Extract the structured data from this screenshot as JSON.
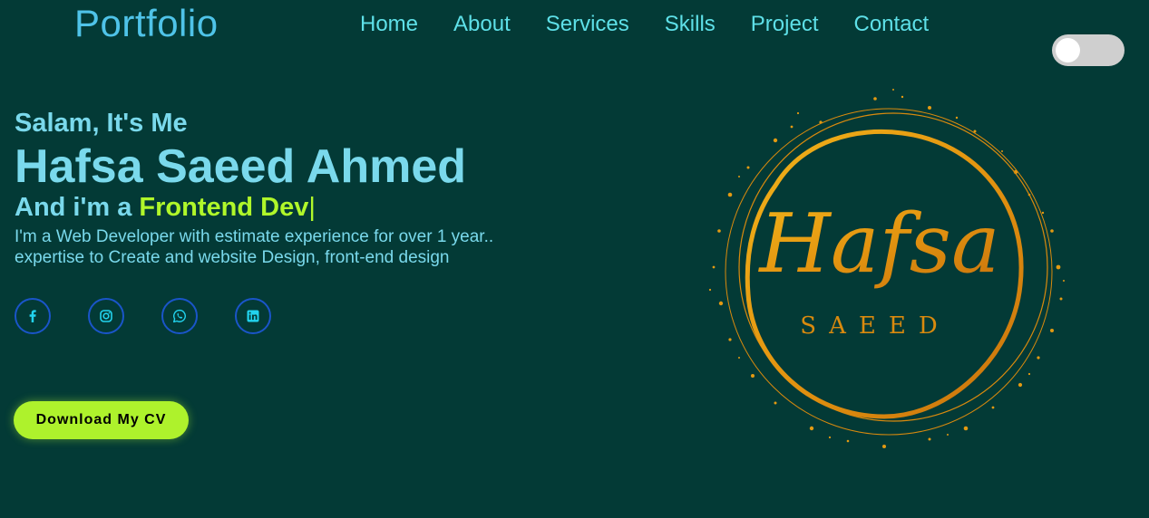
{
  "header": {
    "logo": "Portfolio",
    "nav": [
      "Home",
      "About",
      "Services",
      "Skills",
      "Project",
      "Contact"
    ]
  },
  "hero": {
    "greeting": "Salam, It's Me",
    "name": "Hafsa Saeed Ahmed",
    "role_prefix": "And i'm a ",
    "role_typed": "Frontend Dev",
    "role_cursor": "|",
    "description_line1": "I'm a Web Developer with estimate experience for over 1 year..",
    "description_line2": "expertise to Create and website Design, front-end design",
    "cv_button": "Download My CV"
  },
  "socials": [
    "facebook-icon",
    "instagram-icon",
    "whatsapp-icon",
    "linkedin-icon"
  ],
  "brand_art": {
    "script": "Hafsa",
    "caption": "SAEED"
  },
  "colors": {
    "background": "#033a36",
    "accent": "#b0f72a",
    "text": "#7ad9ec",
    "nav": "#5ee0e8",
    "gold": "#e49a0c"
  },
  "theme_toggle": {
    "state": "off"
  }
}
